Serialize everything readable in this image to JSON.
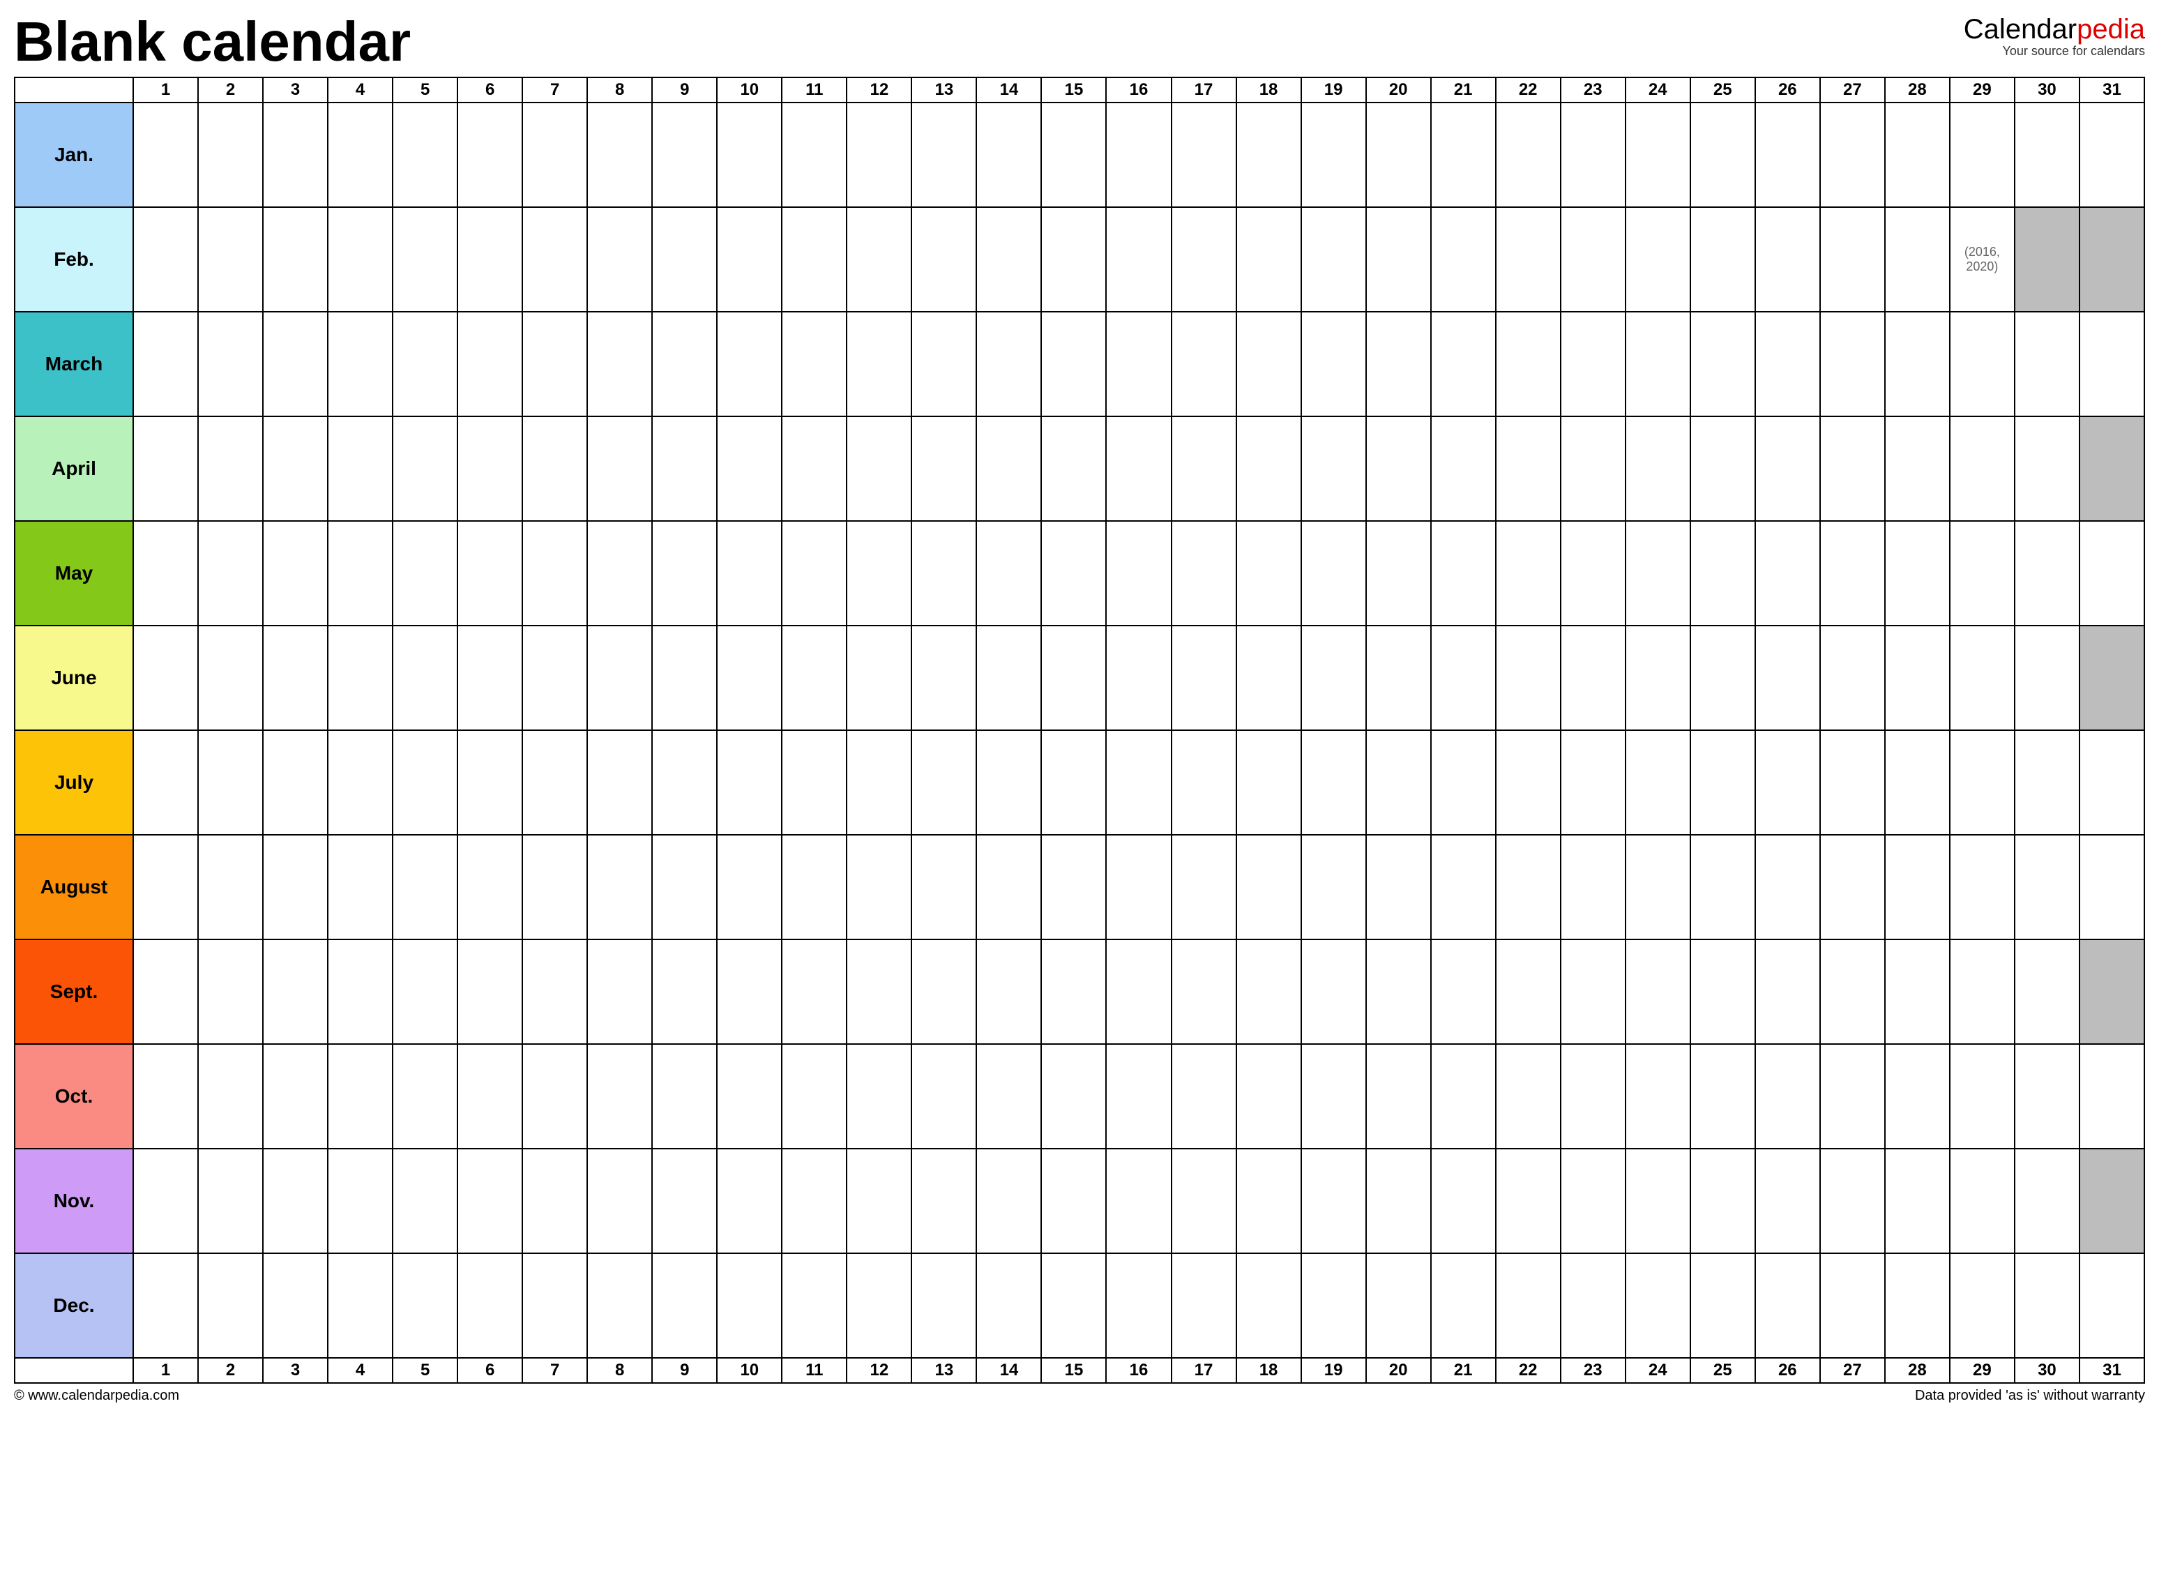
{
  "title": "Blank calendar",
  "brand": {
    "name_plain": "Calendar",
    "name_accent": "pedia",
    "tagline": "Your source for calendars"
  },
  "days": [
    "1",
    "2",
    "3",
    "4",
    "5",
    "6",
    "7",
    "8",
    "9",
    "10",
    "11",
    "12",
    "13",
    "14",
    "15",
    "16",
    "17",
    "18",
    "19",
    "20",
    "21",
    "22",
    "23",
    "24",
    "25",
    "26",
    "27",
    "28",
    "29",
    "30",
    "31"
  ],
  "months": [
    {
      "label": "Jan.",
      "color": "#9ecaf8",
      "grey_from": null,
      "note": null,
      "note_day": null
    },
    {
      "label": "Feb.",
      "color": "#c9f4fb",
      "grey_from": 30,
      "note": "(2016, 2020)",
      "note_day": 29
    },
    {
      "label": "March",
      "color": "#3dc1c8",
      "grey_from": null,
      "note": null,
      "note_day": null
    },
    {
      "label": "April",
      "color": "#b8f2ba",
      "grey_from": 31,
      "note": null,
      "note_day": null
    },
    {
      "label": "May",
      "color": "#84c91a",
      "grey_from": null,
      "note": null,
      "note_day": null
    },
    {
      "label": "June",
      "color": "#f7f98d",
      "grey_from": 31,
      "note": null,
      "note_day": null
    },
    {
      "label": "July",
      "color": "#fcc307",
      "grey_from": null,
      "note": null,
      "note_day": null
    },
    {
      "label": "August",
      "color": "#fb8f07",
      "grey_from": null,
      "note": null,
      "note_day": null
    },
    {
      "label": "Sept.",
      "color": "#fb5406",
      "grey_from": 31,
      "note": null,
      "note_day": null
    },
    {
      "label": "Oct.",
      "color": "#f98b82",
      "grey_from": null,
      "note": null,
      "note_day": null
    },
    {
      "label": "Nov.",
      "color": "#ce9bf6",
      "grey_from": 31,
      "note": null,
      "note_day": null
    },
    {
      "label": "Dec.",
      "color": "#b7c2f4",
      "grey_from": null,
      "note": null,
      "note_day": null
    }
  ],
  "footer": {
    "left": "© www.calendarpedia.com",
    "right": "Data provided 'as is' without warranty"
  }
}
